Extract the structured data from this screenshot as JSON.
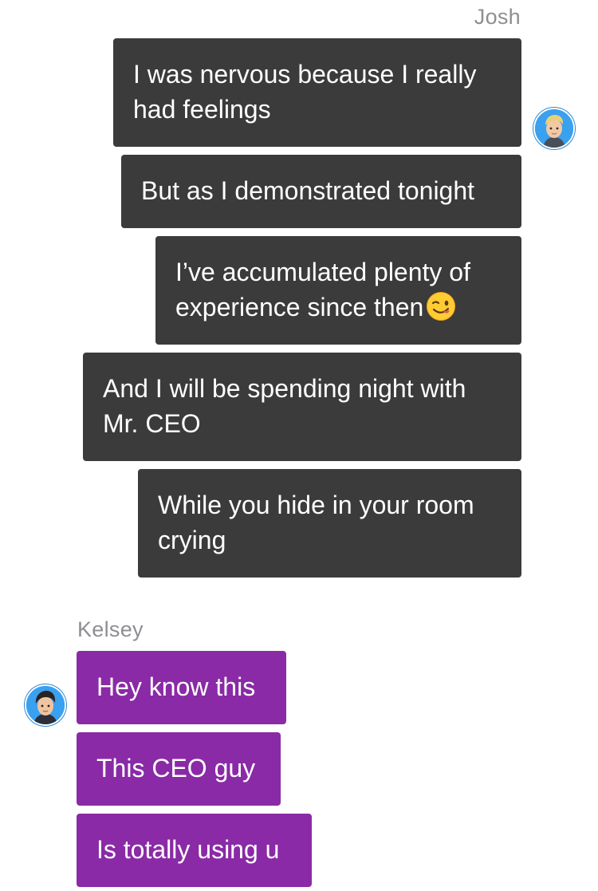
{
  "chat": {
    "josh": {
      "name": "Josh",
      "messages": [
        "I was nervous because I really had feelings",
        "But as I demonstrated tonight",
        "I’ve accumulated plenty of experience since then",
        "And I will be spending night with Mr. CEO",
        "While you hide in your room crying"
      ],
      "bubble_color": "#3b3b3b",
      "avatar_icon": "josh-avatar"
    },
    "kelsey": {
      "name": "Kelsey",
      "messages": [
        "Hey know this",
        "This CEO guy",
        "Is totally using u"
      ],
      "bubble_color": "#8a2aa6",
      "avatar_icon": "kelsey-avatar"
    },
    "emoji": "winking-face-emoji"
  }
}
